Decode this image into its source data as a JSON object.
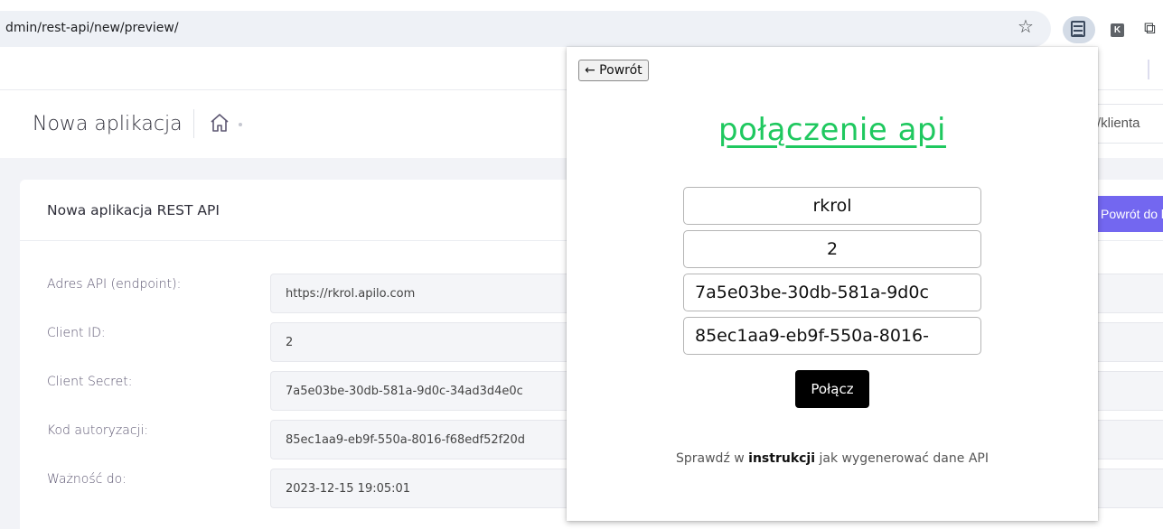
{
  "browser": {
    "url": "dmin/rest-api/new/preview/",
    "icons": [
      "star-icon",
      "extension-list-icon",
      "extension-k-icon",
      "puzzle-icon"
    ]
  },
  "header": {
    "page_title": "Nowa aplikacja",
    "client_input_text": "/klienta"
  },
  "card": {
    "title": "Nowa aplikacja REST API",
    "back_button": "Powrót do li",
    "fields": [
      {
        "label": "Adres API (endpoint):",
        "value": "https://rkrol.apilo.com"
      },
      {
        "label": "Client ID:",
        "value": "2"
      },
      {
        "label": "Client Secret:",
        "value": "7a5e03be-30db-581a-9d0c-34ad3d4e0c"
      },
      {
        "label": "Kod autoryzacji:",
        "value": "85ec1aa9-eb9f-550a-8016-f68edf52f20d"
      },
      {
        "label": "Ważność do:",
        "value": "2023-12-15 19:05:01"
      }
    ]
  },
  "popup": {
    "back_label": "← Powrót",
    "title": "połączenie api",
    "inputs": [
      "rkrol",
      "2",
      "7a5e03be-30db-581a-9d0c",
      "85ec1aa9-eb9f-550a-8016-"
    ],
    "connect_label": "Połącz",
    "help_prefix": "Sprawdź w ",
    "help_link": "instrukcji",
    "help_suffix": " jak wygenerować dane API"
  },
  "colors": {
    "accent": "#7367f0",
    "popup_title": "#1fc85f",
    "connect_button": "#000000"
  }
}
